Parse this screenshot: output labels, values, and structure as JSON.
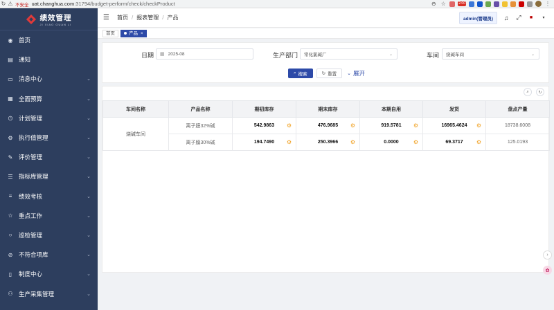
{
  "browser": {
    "insecure_label": "不安全",
    "url_host": "uat.changhua.com",
    "url_path": ":31794/budget-perform/check/checkProduct",
    "ext_badge": "2.00"
  },
  "sidebar": {
    "logo_title": "绩效管理",
    "logo_sub": "JI XIAO GUAN LI",
    "items": [
      {
        "label": "首页",
        "icon": "dashboard-icon",
        "glyph": "◉",
        "has_children": false
      },
      {
        "label": "通知",
        "icon": "message-icon",
        "glyph": "▤",
        "has_children": false
      },
      {
        "label": "消息中心",
        "icon": "chat-icon",
        "glyph": "▭",
        "has_children": true
      },
      {
        "label": "全面预算",
        "icon": "document-icon",
        "glyph": "▦",
        "has_children": true
      },
      {
        "label": "计划管理",
        "icon": "clock-icon",
        "glyph": "◷",
        "has_children": true
      },
      {
        "label": "执行值管理",
        "icon": "settings-icon",
        "glyph": "⚙",
        "has_children": true
      },
      {
        "label": "评价管理",
        "icon": "edit-icon",
        "glyph": "✎",
        "has_children": true
      },
      {
        "label": "指标库管理",
        "icon": "sliders-icon",
        "glyph": "☰",
        "has_children": true
      },
      {
        "label": "绩效考核",
        "icon": "list-icon",
        "glyph": "≡",
        "has_children": true
      },
      {
        "label": "重点工作",
        "icon": "star-icon",
        "glyph": "☆",
        "has_children": true
      },
      {
        "label": "巡检管理",
        "icon": "circle-icon",
        "glyph": "○",
        "has_children": true
      },
      {
        "label": "不符合项库",
        "icon": "ban-icon",
        "glyph": "⊘",
        "has_children": true
      },
      {
        "label": "制度中心",
        "icon": "book-icon",
        "glyph": "▯",
        "has_children": true
      },
      {
        "label": "生产采集管理",
        "icon": "group-icon",
        "glyph": "⚇",
        "has_children": true
      }
    ]
  },
  "header": {
    "breadcrumb": [
      "首页",
      "报表管理",
      "产品"
    ],
    "user_label": "admin(管理员)"
  },
  "tabs": [
    {
      "label": "首页",
      "active": false
    },
    {
      "label": "产品",
      "active": true
    }
  ],
  "filters": {
    "date_label": "日期",
    "date_value": "2025-08",
    "dept_label": "生产部门",
    "dept_value": "常化氯碱厂",
    "workshop_label": "车间",
    "workshop_value": "烧碱车间",
    "search_label": "搜索",
    "reset_label": "重置",
    "expand_label": "展开"
  },
  "table": {
    "columns": [
      "车间名称",
      "产品名称",
      "期初库存",
      "期末库存",
      "本期自用",
      "发货",
      "盘点产量"
    ],
    "workshop": "烧碱车间",
    "rows": [
      {
        "product": "离子膜32%碱",
        "opening": "542.9863",
        "closing": "476.9685",
        "self_use": "919.5781",
        "shipped": "16965.4624",
        "inventory": "18738.6008"
      },
      {
        "product": "离子膜30%碱",
        "opening": "194.7490",
        "closing": "250.3966",
        "self_use": "0.0000",
        "shipped": "69.3717",
        "inventory": "125.0193"
      }
    ]
  }
}
